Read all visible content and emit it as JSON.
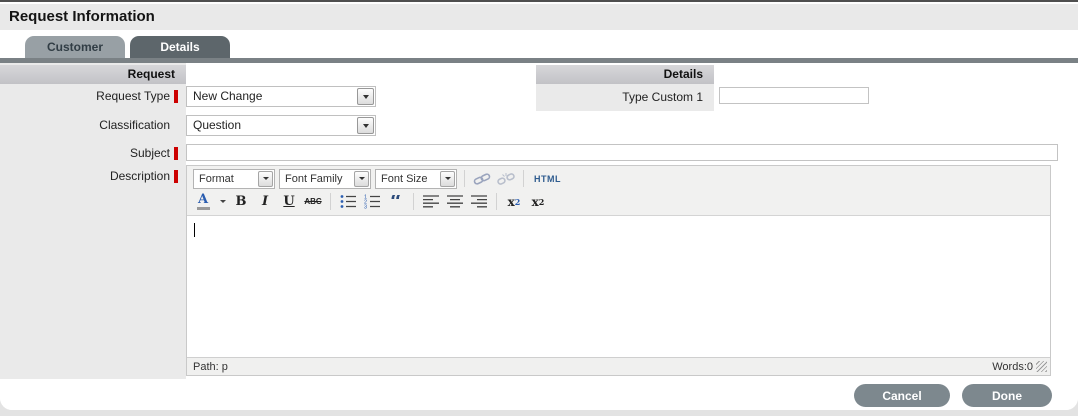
{
  "window": {
    "title": "Request Information"
  },
  "tabs": {
    "customer": "Customer",
    "details": "Details"
  },
  "form": {
    "request_section_header": "Request",
    "details_section_header": "Details",
    "request_type": {
      "label": "Request Type",
      "required": true,
      "value": "New Change"
    },
    "classification": {
      "label": "Classification",
      "required": false,
      "value": "Question"
    },
    "subject": {
      "label": "Subject",
      "required": true,
      "value": ""
    },
    "description": {
      "label": "Description",
      "required": true
    },
    "type_custom_1": {
      "label": "Type Custom 1",
      "value": ""
    }
  },
  "editor": {
    "format_select": "Format",
    "font_family_select": "Font Family",
    "font_size_select": "Font Size",
    "html_button": "HTML",
    "icons": {
      "forecolor": "A",
      "bold": "B",
      "italic": "I",
      "underline": "U",
      "strikethrough": "ABC",
      "blockquote": "“",
      "sub_base": "x",
      "sub_digit": "2",
      "sup_base": "x",
      "sup_digit": "2"
    },
    "statusbar": {
      "path": "Path: p",
      "words": "Words:0"
    }
  },
  "footer": {
    "cancel": "Cancel",
    "done": "Done"
  },
  "colors": {
    "required_marker": "#cc0000",
    "active_tab_bg": "#5d666b",
    "inactive_tab_bg": "#98a0a5",
    "tab_bar": "#7a8185",
    "button_bg": "#7d888e",
    "accent_blue": "#2a5db0",
    "section_header_bg": "#c9c9cd",
    "label_column_bg": "#eaeaea"
  }
}
